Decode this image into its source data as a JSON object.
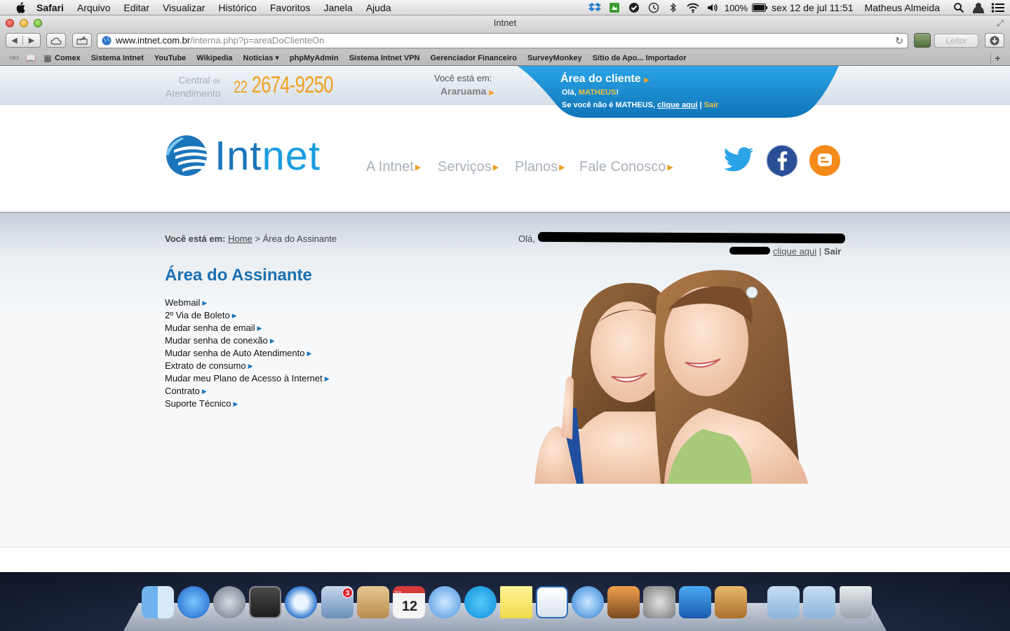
{
  "menubar": {
    "app": "Safari",
    "items": [
      "Arquivo",
      "Editar",
      "Visualizar",
      "Histórico",
      "Favoritos",
      "Janela",
      "Ajuda"
    ],
    "battery": "100%",
    "datetime": "sex 12 de jul  11:51",
    "user": "Matheus Almeida",
    "icons": [
      "dropbox-icon",
      "evernote-icon",
      "check-icon",
      "time-machine-icon",
      "bluetooth-icon",
      "wifi-icon",
      "volume-icon",
      "battery-icon",
      "spotlight-icon",
      "user-icon",
      "notification-list-icon"
    ]
  },
  "window": {
    "title": "Intnet",
    "url_host": "www.intnet.com.br",
    "url_path": "/interna.php?p=areaDoClienteOn",
    "reader_label": "Leitor"
  },
  "bookmarks": [
    "Comex",
    "Sistema Intnet",
    "YouTube",
    "Wikipedia",
    "Notícias ▾",
    "phpMyAdmin",
    "Sistema Intnet VPN",
    "Gerenciador Financeiro",
    "SurveyMonkey",
    "Sítio de Apo... Importador"
  ],
  "header": {
    "central_line1": "Central",
    "central_de": "de",
    "central_line2": "Atendimento",
    "phone_ddd": "22",
    "phone_number": "2674-9250",
    "location_label": "Você está em:",
    "location_city": "Araruama",
    "client_title": "Área do cliente",
    "client_hello_prefix": "Olá,",
    "client_name": "MATHEUS",
    "client_hello_suffix": "!",
    "client_notyou": "Se você não é MATHEUS,",
    "client_click": "clique aqui",
    "client_sep": "|",
    "client_logout": "Sair"
  },
  "logo": {
    "part1": "Int",
    "part2": "net"
  },
  "nav": [
    "A Intnet",
    "Serviços",
    "Planos",
    "Fale Conosco"
  ],
  "social": [
    "twitter-icon",
    "facebook-icon",
    "blogger-icon"
  ],
  "content": {
    "breadcrumb_label": "Você está em:",
    "breadcrumb_home": "Home",
    "breadcrumb_sep": ">",
    "breadcrumb_current": "Área do Assinante",
    "greet": "Olá,",
    "logout_click": "clique aqui",
    "logout_sep": "|",
    "logout": "Sair",
    "title": "Área do Assinante",
    "links": [
      "Webmail",
      "2º Via de Boleto",
      "Mudar senha de email",
      "Mudar senha de conexão",
      "Mudar senha de Auto Atendimento",
      "Extrato de consumo",
      "Mudar meu Plano de Acesso à Internet",
      "Contrato",
      "Suporte Técnico"
    ]
  },
  "dock": {
    "mail_badge": "3",
    "calendar_month": "JUL",
    "calendar_day": "12",
    "apps": [
      "finder-icon",
      "app-store-icon",
      "launchpad-icon",
      "photo-booth-icon",
      "safari-icon",
      "mail-icon",
      "contacts-icon",
      "calendar-icon",
      "messages-icon",
      "skype-icon",
      "notes-icon",
      "reminders-icon",
      "itunes-icon",
      "iphoto-icon",
      "system-preferences-icon",
      "word-icon",
      "package-icon",
      "documents-folder-icon",
      "downloads-folder-icon",
      "trash-icon"
    ]
  },
  "colors": {
    "brand_blue": "#1a75bb",
    "brand_orange": "#f0a020",
    "client_box": "#1a8fd0"
  }
}
